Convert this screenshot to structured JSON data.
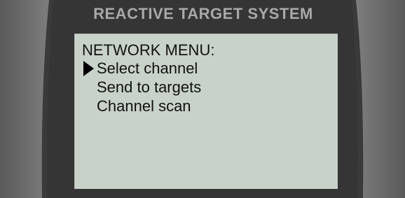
{
  "device": {
    "brand_label": "REACTIVE TARGET SYSTEM"
  },
  "screen": {
    "menu_title": "NETWORK MENU:",
    "selected_index": 0,
    "cursor_icon": "triangle-right-icon",
    "items": [
      {
        "label": "Select channel"
      },
      {
        "label": "Send to targets"
      },
      {
        "label": "Channel scan"
      }
    ]
  }
}
